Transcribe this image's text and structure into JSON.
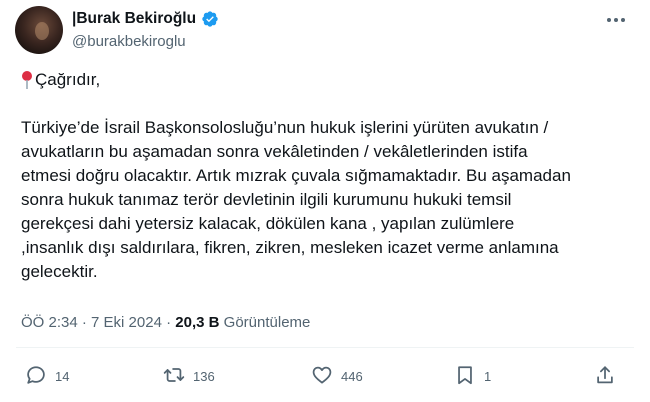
{
  "author": {
    "name": "|Burak Bekiroğlu",
    "handle": "@burakbekiroglu",
    "verified": true,
    "accent_color": "#1d9bf0"
  },
  "tweet": {
    "greeting": "Çağrıdır,",
    "greeting_icon": "round-pushpin-emoji",
    "lines": [
      "Türkiye’de İsrail Başkonsolosluğu’nun hukuk işlerini yürüten avukatın /",
      "avukatların bu aşamadan sonra vekâletinden / vekâletlerinden istifa",
      "etmesi doğru olacaktır. Artık mızrak çuvala sığmamaktadır. Bu aşamadan",
      "sonra hukuk tanımaz terör devletinin ilgili kurumunu hukuki temsil",
      "gerekçesi dahi yetersiz kalacak, dökülen kana , yapılan zulümlere",
      ",insanlık dışı saldırılara, fikren, zikren, mesleken icazet verme anlamına",
      "gelecektir."
    ]
  },
  "meta": {
    "time": "ÖÖ 2:34",
    "separator": "·",
    "date": "7 Eki 2024",
    "views": "20,3 B",
    "views_label": "Görüntüleme"
  },
  "actions": {
    "replies": "14",
    "reposts": "136",
    "likes": "446",
    "bookmarks": "1"
  }
}
